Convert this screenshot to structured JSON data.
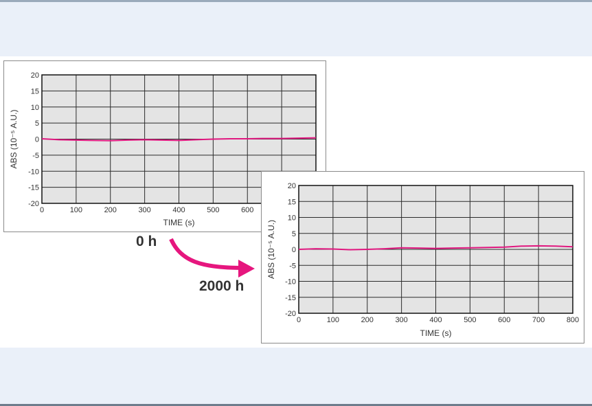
{
  "colors": {
    "series": "#e0177f",
    "plot_bg": "#e4e4e4",
    "grid": "#2a2a2a",
    "arrow": "#e6167e"
  },
  "annotations": {
    "start": "0 h",
    "end": "2000 h",
    "arrow_icon": "curved-arrow"
  },
  "chart_data": [
    {
      "type": "line",
      "xlabel": "TIME (s)",
      "ylabel": "ABS (10⁻⁵ A.U.)",
      "xlim": [
        0,
        800
      ],
      "ylim": [
        -20,
        20
      ],
      "xticks": [
        "0",
        "100",
        "200",
        "300",
        "400",
        "500",
        "600"
      ],
      "yticks": [
        "20",
        "15",
        "10",
        "5",
        "0",
        "-5",
        "-10",
        "-15",
        "-20"
      ],
      "grid": true,
      "series": [
        {
          "x": [
            0,
            50,
            100,
            150,
            200,
            250,
            300,
            350,
            400,
            450,
            500,
            550,
            600,
            650,
            700,
            750,
            800
          ],
          "y": [
            0.1,
            -0.2,
            -0.3,
            -0.4,
            -0.5,
            -0.3,
            -0.2,
            -0.3,
            -0.4,
            -0.2,
            0.0,
            0.1,
            0.1,
            0.2,
            0.2,
            0.3,
            0.4
          ]
        }
      ]
    },
    {
      "type": "line",
      "xlabel": "TIME (s)",
      "ylabel": "ABS (10⁻⁵ A.U.)",
      "xlim": [
        0,
        800
      ],
      "ylim": [
        -20,
        20
      ],
      "xticks": [
        "0",
        "100",
        "200",
        "300",
        "400",
        "500",
        "600",
        "700",
        "800"
      ],
      "yticks": [
        "20",
        "15",
        "10",
        "5",
        "0",
        "-5",
        "-10",
        "-15",
        "-20"
      ],
      "grid": true,
      "series": [
        {
          "x": [
            0,
            50,
            100,
            150,
            200,
            250,
            300,
            350,
            400,
            450,
            500,
            550,
            600,
            650,
            700,
            750,
            800
          ],
          "y": [
            0.0,
            0.2,
            0.1,
            -0.1,
            0.0,
            0.2,
            0.5,
            0.4,
            0.3,
            0.4,
            0.5,
            0.6,
            0.7,
            1.0,
            1.1,
            1.0,
            0.8
          ]
        }
      ]
    }
  ]
}
